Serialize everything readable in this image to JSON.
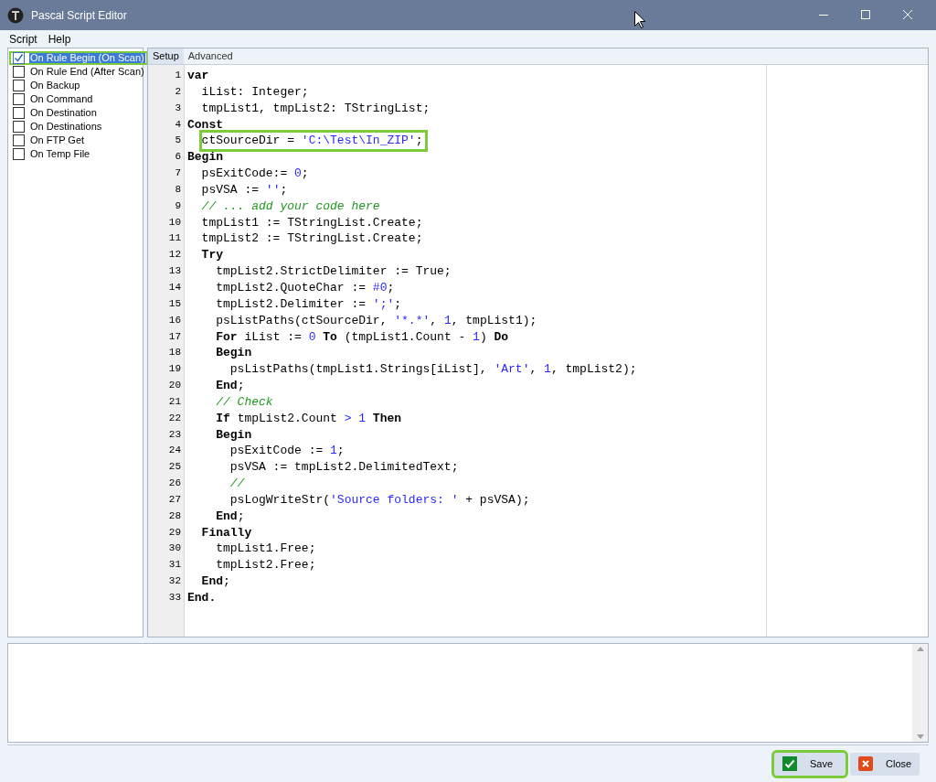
{
  "window": {
    "title": "Pascal Script Editor"
  },
  "menu": [
    "Script",
    "Help"
  ],
  "events": [
    {
      "label": "On Rule Begin (On Scan)",
      "checked": true,
      "selected": true,
      "highlighted": true
    },
    {
      "label": "On Rule End (After Scan)",
      "checked": false,
      "selected": false,
      "highlighted": false
    },
    {
      "label": "On Backup",
      "checked": false,
      "selected": false,
      "highlighted": false
    },
    {
      "label": "On Command",
      "checked": false,
      "selected": false,
      "highlighted": false
    },
    {
      "label": "On Destination",
      "checked": false,
      "selected": false,
      "highlighted": false
    },
    {
      "label": "On Destinations",
      "checked": false,
      "selected": false,
      "highlighted": false
    },
    {
      "label": "On FTP Get",
      "checked": false,
      "selected": false,
      "highlighted": false
    },
    {
      "label": "On Temp File",
      "checked": false,
      "selected": false,
      "highlighted": false
    }
  ],
  "tabs": [
    {
      "label": "Setup",
      "selected": true
    },
    {
      "label": "Advanced",
      "selected": false
    }
  ],
  "code": [
    {
      "n": "1",
      "highlighted": false,
      "tokens": [
        {
          "kind": "kw",
          "t": "var"
        }
      ]
    },
    {
      "n": "2",
      "highlighted": false,
      "tokens": [
        {
          "kind": "plain",
          "t": "  iList: Integer;"
        }
      ]
    },
    {
      "n": "3",
      "highlighted": false,
      "tokens": [
        {
          "kind": "plain",
          "t": "  tmpList1, tmpList2: TStringList;"
        }
      ]
    },
    {
      "n": "4",
      "highlighted": false,
      "tokens": [
        {
          "kind": "kw",
          "t": "Const"
        }
      ]
    },
    {
      "n": "5",
      "highlighted": true,
      "tokens": [
        {
          "kind": "plain",
          "t": "  ctSourceDir = "
        },
        {
          "kind": "literal",
          "t": "'C:\\Test\\In_ZIP'"
        },
        {
          "kind": "plain",
          "t": ";"
        }
      ]
    },
    {
      "n": "6",
      "highlighted": false,
      "tokens": [
        {
          "kind": "kw",
          "t": "Begin"
        }
      ]
    },
    {
      "n": "7",
      "highlighted": false,
      "tokens": [
        {
          "kind": "plain",
          "t": "  psExitCode:= "
        },
        {
          "kind": "literal",
          "t": "0"
        },
        {
          "kind": "plain",
          "t": ";"
        }
      ]
    },
    {
      "n": "8",
      "highlighted": false,
      "tokens": [
        {
          "kind": "plain",
          "t": "  psVSA := "
        },
        {
          "kind": "literal",
          "t": "''"
        },
        {
          "kind": "plain",
          "t": ";"
        }
      ]
    },
    {
      "n": "9",
      "highlighted": false,
      "tokens": [
        {
          "kind": "comment",
          "t": "  // ... add your code here"
        }
      ]
    },
    {
      "n": "10",
      "highlighted": false,
      "tokens": [
        {
          "kind": "plain",
          "t": "  tmpList1 := TStringList.Create;"
        }
      ]
    },
    {
      "n": "11",
      "highlighted": false,
      "tokens": [
        {
          "kind": "plain",
          "t": "  tmpList2 := TStringList.Create;"
        }
      ]
    },
    {
      "n": "12",
      "highlighted": false,
      "tokens": [
        {
          "kind": "kw",
          "t": "  Try"
        }
      ]
    },
    {
      "n": "13",
      "highlighted": false,
      "tokens": [
        {
          "kind": "plain",
          "t": "    tmpList2.StrictDelimiter := True;"
        }
      ]
    },
    {
      "n": "14",
      "highlighted": false,
      "tokens": [
        {
          "kind": "plain",
          "t": "    tmpList2.QuoteChar := "
        },
        {
          "kind": "literal",
          "t": "#0"
        },
        {
          "kind": "plain",
          "t": ";"
        }
      ]
    },
    {
      "n": "15",
      "highlighted": false,
      "tokens": [
        {
          "kind": "plain",
          "t": "    tmpList2.Delimiter := "
        },
        {
          "kind": "literal",
          "t": "';'"
        },
        {
          "kind": "plain",
          "t": ";"
        }
      ]
    },
    {
      "n": "16",
      "highlighted": false,
      "tokens": [
        {
          "kind": "plain",
          "t": "    psListPaths(ctSourceDir, "
        },
        {
          "kind": "literal",
          "t": "'*.*'"
        },
        {
          "kind": "plain",
          "t": ", "
        },
        {
          "kind": "literal",
          "t": "1"
        },
        {
          "kind": "plain",
          "t": ", tmpList1);"
        }
      ]
    },
    {
      "n": "17",
      "highlighted": false,
      "tokens": [
        {
          "kind": "kw",
          "t": "    For"
        },
        {
          "kind": "plain",
          "t": " iList := "
        },
        {
          "kind": "literal",
          "t": "0"
        },
        {
          "kind": "kw",
          "t": " To"
        },
        {
          "kind": "plain",
          "t": " (tmpList1.Count - "
        },
        {
          "kind": "literal",
          "t": "1"
        },
        {
          "kind": "plain",
          "t": ") "
        },
        {
          "kind": "kw",
          "t": "Do"
        }
      ]
    },
    {
      "n": "18",
      "highlighted": false,
      "tokens": [
        {
          "kind": "kw",
          "t": "    Begin"
        }
      ]
    },
    {
      "n": "19",
      "highlighted": false,
      "tokens": [
        {
          "kind": "plain",
          "t": "      psListPaths(tmpList1.Strings[iList], "
        },
        {
          "kind": "literal",
          "t": "'Art'"
        },
        {
          "kind": "plain",
          "t": ", "
        },
        {
          "kind": "literal",
          "t": "1"
        },
        {
          "kind": "plain",
          "t": ", tmpList2);"
        }
      ]
    },
    {
      "n": "20",
      "highlighted": false,
      "tokens": [
        {
          "kind": "kw",
          "t": "    End"
        },
        {
          "kind": "plain",
          "t": ";"
        }
      ]
    },
    {
      "n": "21",
      "highlighted": false,
      "tokens": [
        {
          "kind": "comment",
          "t": "    // Check"
        }
      ]
    },
    {
      "n": "22",
      "highlighted": false,
      "tokens": [
        {
          "kind": "kw",
          "t": "    If"
        },
        {
          "kind": "plain",
          "t": " tmpList2.Count "
        },
        {
          "kind": "literal",
          "t": "> 1"
        },
        {
          "kind": "kw",
          "t": " Then"
        }
      ]
    },
    {
      "n": "23",
      "highlighted": false,
      "tokens": [
        {
          "kind": "kw",
          "t": "    Begin"
        }
      ]
    },
    {
      "n": "24",
      "highlighted": false,
      "tokens": [
        {
          "kind": "plain",
          "t": "      psExitCode := "
        },
        {
          "kind": "literal",
          "t": "1"
        },
        {
          "kind": "plain",
          "t": ";"
        }
      ]
    },
    {
      "n": "25",
      "highlighted": false,
      "tokens": [
        {
          "kind": "plain",
          "t": "      psVSA := tmpList2.DelimitedText;"
        }
      ]
    },
    {
      "n": "26",
      "highlighted": false,
      "tokens": [
        {
          "kind": "comment",
          "t": "      //"
        }
      ]
    },
    {
      "n": "27",
      "highlighted": false,
      "tokens": [
        {
          "kind": "plain",
          "t": "      psLogWriteStr("
        },
        {
          "kind": "literal",
          "t": "'Source folders: '"
        },
        {
          "kind": "plain",
          "t": " + psVSA);"
        }
      ]
    },
    {
      "n": "28",
      "highlighted": false,
      "tokens": [
        {
          "kind": "kw",
          "t": "    End"
        },
        {
          "kind": "plain",
          "t": ";"
        }
      ]
    },
    {
      "n": "29",
      "highlighted": false,
      "tokens": [
        {
          "kind": "kw",
          "t": "  Finally"
        }
      ]
    },
    {
      "n": "30",
      "highlighted": false,
      "tokens": [
        {
          "kind": "plain",
          "t": "    tmpList1.Free;"
        }
      ]
    },
    {
      "n": "31",
      "highlighted": false,
      "tokens": [
        {
          "kind": "plain",
          "t": "    tmpList2.Free;"
        }
      ]
    },
    {
      "n": "32",
      "highlighted": false,
      "tokens": [
        {
          "kind": "kw",
          "t": "  End"
        },
        {
          "kind": "plain",
          "t": ";"
        }
      ]
    },
    {
      "n": "33",
      "highlighted": false,
      "tokens": [
        {
          "kind": "kw",
          "t": "End."
        }
      ]
    }
  ],
  "buttons": [
    {
      "kind": "save",
      "label": "Save",
      "highlighted": true
    },
    {
      "kind": "close",
      "label": "Close",
      "highlighted": false
    }
  ]
}
